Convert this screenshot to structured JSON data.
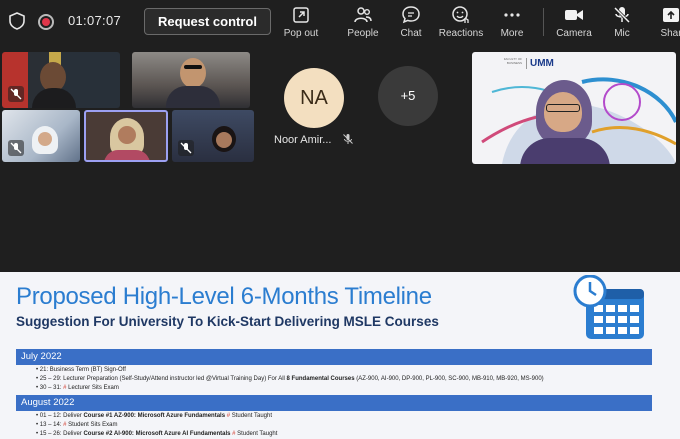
{
  "toolbar": {
    "timer": "01:07:07",
    "request_control": "Request control",
    "items": [
      {
        "label": "Pop out",
        "icon": "pop-out-icon"
      },
      {
        "label": "People",
        "icon": "people-icon"
      },
      {
        "label": "Chat",
        "icon": "chat-icon"
      },
      {
        "label": "Reactions",
        "icon": "reactions-icon"
      },
      {
        "label": "More",
        "icon": "more-icon"
      },
      {
        "label": "Camera",
        "icon": "camera-icon"
      },
      {
        "label": "Mic",
        "icon": "mic-off-icon"
      },
      {
        "label": "Shar",
        "icon": "share-icon"
      }
    ]
  },
  "gallery": {
    "participant_initials": "NA",
    "participant_name": "Noor Amir...",
    "overflow_count": "+5",
    "presenter_logo_text": "UMM"
  },
  "slide": {
    "title": "Proposed High-Level 6-Months Timeline",
    "subtitle": "Suggestion For University To Kick-Start Delivering MSLE Courses",
    "sections": [
      {
        "month": "July 2022",
        "lines": [
          {
            "pre": "• 21: Business Term (BT) Sign-Off",
            "bold": "",
            "mark": "",
            "post": ""
          },
          {
            "pre": "• 25 – 29: Lecturer Preparation (Self-Study/Attend instructor led @Virtual Training Day) For All ",
            "bold": "8 Fundamental Courses",
            "mark": "",
            "post": " (AZ-900, AI-900, DP-900, PL-900, SC-900, MB-910, MB-920, MS-900)"
          },
          {
            "pre": "• 30 – 31: ",
            "bold": "",
            "mark": "#",
            "post": " Lecturer Sits Exam"
          }
        ]
      },
      {
        "month": "August 2022",
        "lines": [
          {
            "pre": "• 01 – 12: Deliver ",
            "bold": "Course #1 AZ-900: Microsoft Azure Fundamentals",
            "mark": " #",
            "post": " Student Taught"
          },
          {
            "pre": "• 13 – 14: ",
            "bold": "",
            "mark": "#",
            "post": " Student Sits Exam"
          },
          {
            "pre": "• 15 – 26: Deliver ",
            "bold": "Course #2 AI-900: Microsoft Azure AI Fundamentals",
            "mark": " #",
            "post": " Student Taught"
          }
        ]
      }
    ]
  },
  "colors": {
    "title_blue": "#2b7dd0",
    "band_blue": "#3a6fc6",
    "record_red": "#e0364a",
    "accent_border": "#9ca0f2"
  }
}
